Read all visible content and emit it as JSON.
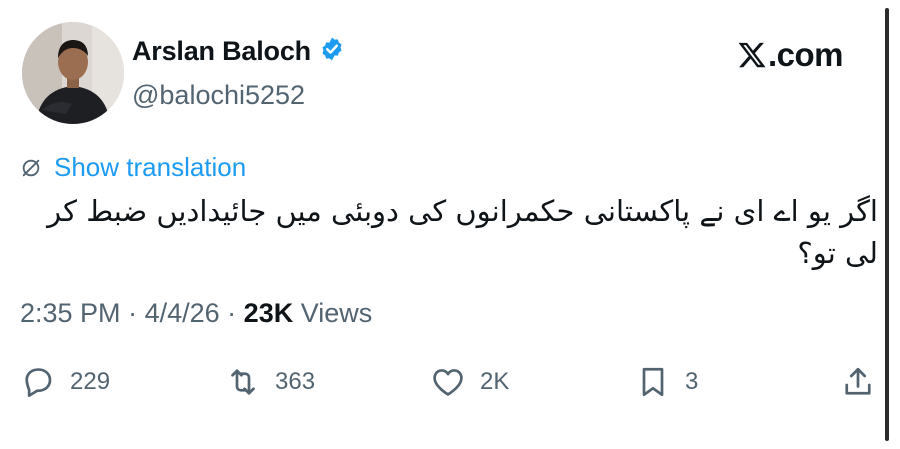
{
  "author": {
    "display_name": "Arslan Baloch",
    "handle": "@balochi5252",
    "verified": true
  },
  "brand": {
    "label": ".com"
  },
  "translation": {
    "label": "Show translation"
  },
  "tweet": {
    "text": "اگر یو اے ای نے پاکستانی حکمرانوں کی دوبئی میں جائیدادیں ضبط کر لی تو؟",
    "time": "2:35 PM",
    "date": "4/4/26",
    "views_count": "23K",
    "views_label": "Views"
  },
  "actions": {
    "replies": "229",
    "reposts": "363",
    "likes": "2K",
    "bookmarks": "3"
  },
  "colors": {
    "accent": "#1d9bf0",
    "secondary": "#536471",
    "text": "#0f1419"
  }
}
